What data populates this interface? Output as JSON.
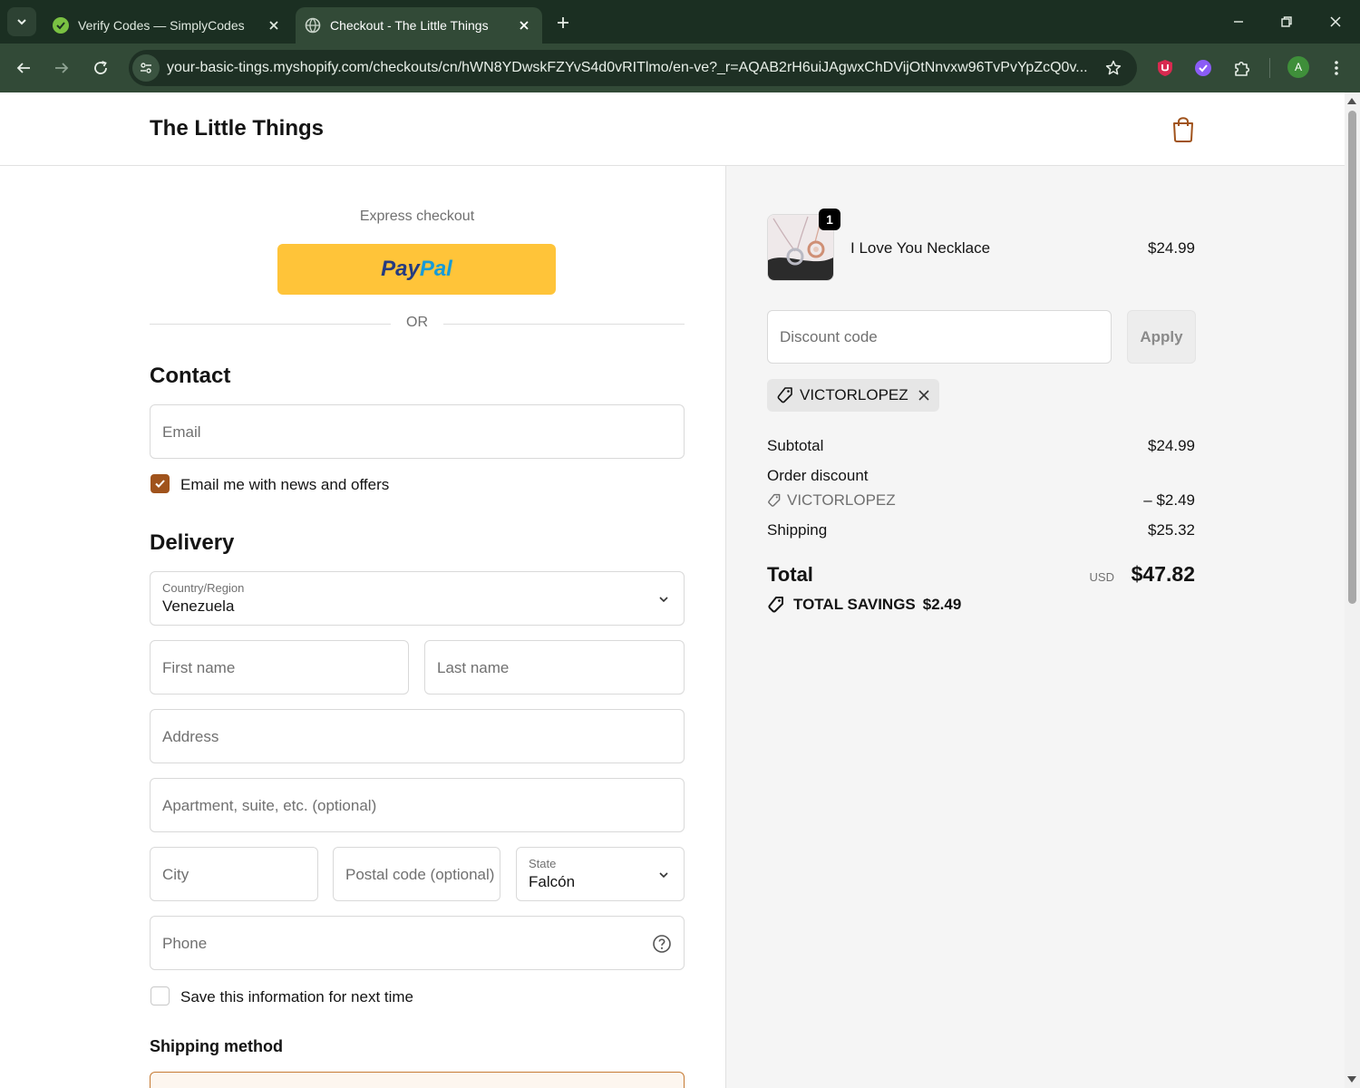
{
  "browser": {
    "tabs": [
      {
        "title": "Verify Codes — SimplyCodes",
        "active": false
      },
      {
        "title": "Checkout - The Little Things",
        "active": true
      }
    ],
    "url": "your-basic-tings.myshopify.com/checkouts/cn/hWN8YDwskFZYvS4d0vRITlmo/en-ve?_r=AQAB2rH6uiJAgwxChDVijOtNnvxw96TvPvYpZcQ0v...",
    "profile_initial": "A",
    "colors": {
      "tabbar": "#1b2f22",
      "toolbar": "#324a37"
    }
  },
  "store": {
    "name": "The Little Things"
  },
  "express": {
    "label": "Express checkout",
    "paypal_pay": "Pay",
    "paypal_pal": "Pal",
    "or_text": "OR"
  },
  "contact": {
    "title": "Contact",
    "email_placeholder": "Email",
    "newsletter_label": "Email me with news and offers",
    "newsletter_checked": true
  },
  "delivery": {
    "title": "Delivery",
    "country_label": "Country/Region",
    "country_value": "Venezuela",
    "first_name_placeholder": "First name",
    "last_name_placeholder": "Last name",
    "address_placeholder": "Address",
    "apartment_placeholder": "Apartment, suite, etc. (optional)",
    "city_placeholder": "City",
    "postal_placeholder": "Postal code (optional)",
    "state_label": "State",
    "state_value": "Falcón",
    "phone_placeholder": "Phone",
    "save_info_label": "Save this information for next time",
    "save_info_checked": false
  },
  "shipping": {
    "title": "Shipping method"
  },
  "summary": {
    "item": {
      "name": "I Love You Necklace",
      "price": "$24.99",
      "quantity": "1"
    },
    "discount_placeholder": "Discount code",
    "apply_label": "Apply",
    "applied_code": "VICTORLOPEZ",
    "subtotal_label": "Subtotal",
    "subtotal_value": "$24.99",
    "order_discount_label": "Order discount",
    "order_discount_code": "VICTORLOPEZ",
    "order_discount_value": "– $2.49",
    "shipping_label": "Shipping",
    "shipping_value": "$25.32",
    "total_label": "Total",
    "currency": "USD",
    "total_value": "$47.82",
    "savings_label": "TOTAL SAVINGS",
    "savings_value": "$2.49"
  },
  "theme": {
    "accent": "#a0531c",
    "paypal_yellow": "#ffc439"
  }
}
